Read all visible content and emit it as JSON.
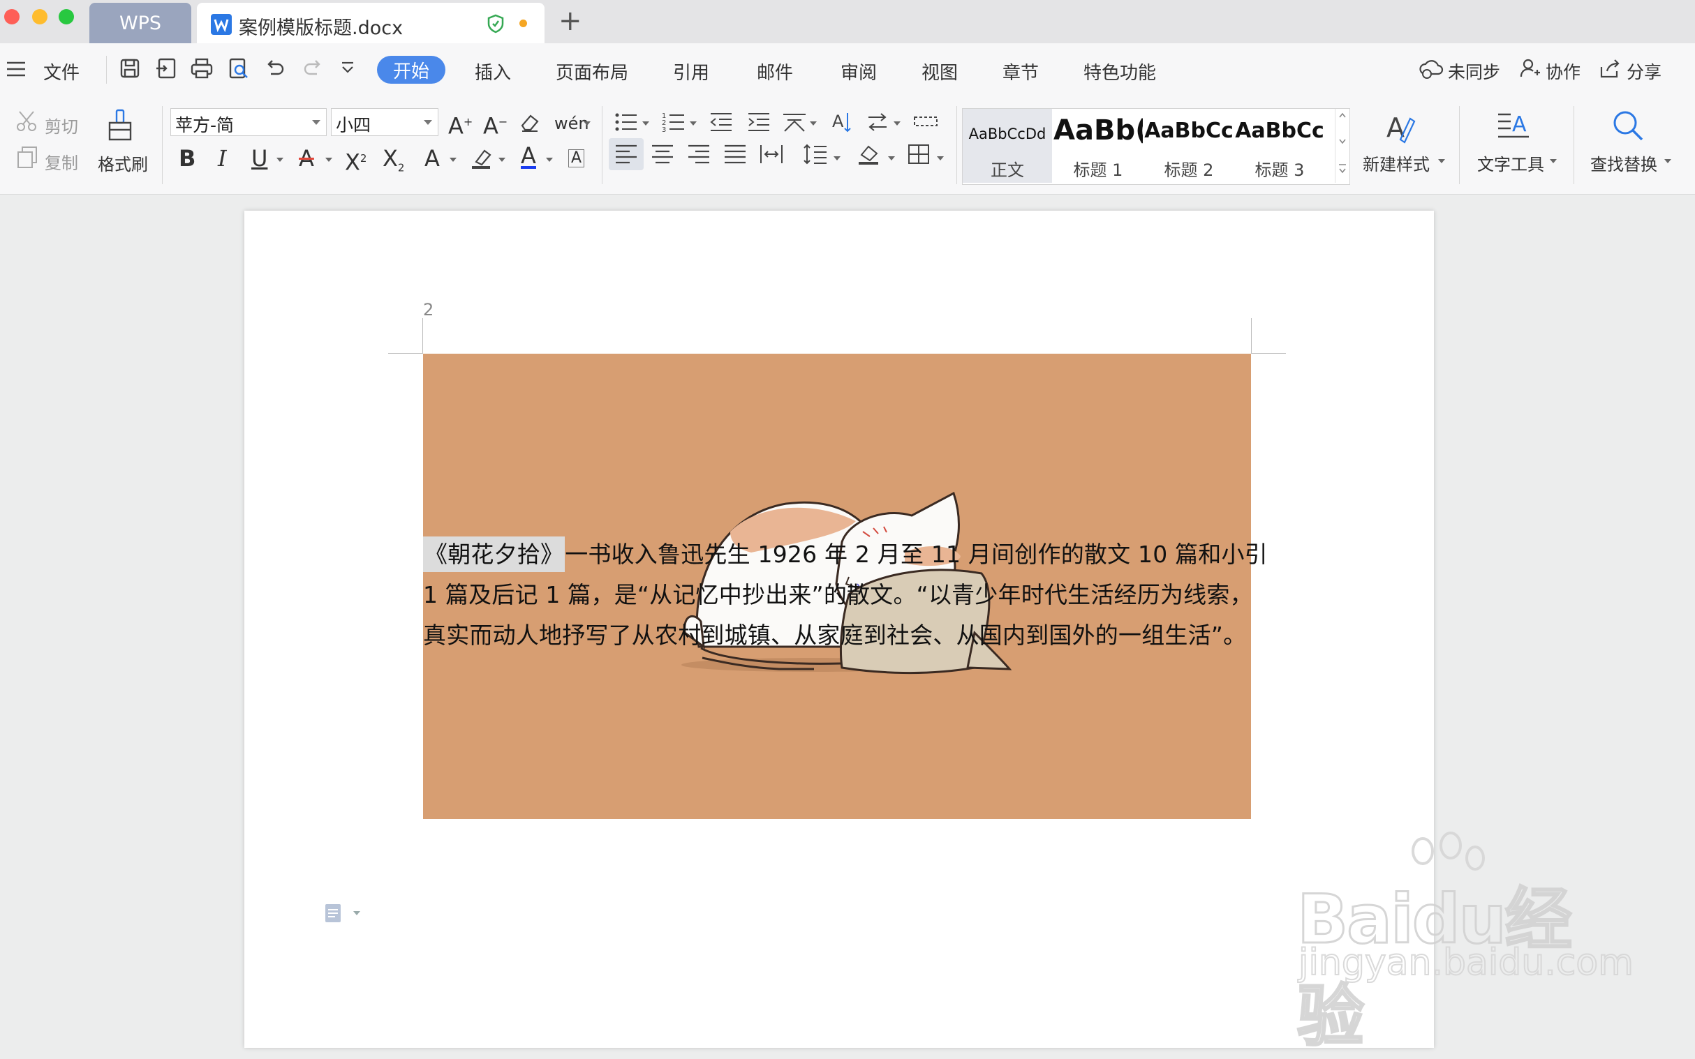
{
  "window": {
    "tabs": [
      {
        "label": "WPS"
      },
      {
        "label": "案例模版标题.docx"
      }
    ]
  },
  "menu": {
    "file_label": "文件",
    "tabs": [
      "开始",
      "插入",
      "页面布局",
      "引用",
      "邮件",
      "审阅",
      "视图",
      "章节",
      "特色功能"
    ],
    "active_tab": "开始",
    "right": {
      "sync": "未同步",
      "collab": "协作",
      "share": "分享"
    }
  },
  "ribbon": {
    "cut": "剪切",
    "copy": "复制",
    "format_painter": "格式刷",
    "font_name": "苹方-简",
    "font_size": "小四",
    "styles": [
      {
        "sample": "AaBbCcDd",
        "name": "正文"
      },
      {
        "sample": "AaBb(",
        "name": "标题 1"
      },
      {
        "sample": "AaBbCc",
        "name": "标题 2"
      },
      {
        "sample": "AaBbCc",
        "name": "标题 3"
      }
    ],
    "new_style": "新建样式",
    "text_tools": "文字工具",
    "find_replace": "查找替换"
  },
  "document": {
    "page_number": "2",
    "highlighted": "《朝花夕拾》",
    "line1_rest": "一书收入鲁迅先生 1926 年 2 月至 11 月间创作的散文 10 篇和小引",
    "line2": "1 篇及后记 1 篇，是“从记忆中抄出来”的散文。“以青少年时代生活经历为线索，",
    "line3": "真实而动人地抒写了从农村到城镇、从家庭到社会、从国内到国外的一组生活”。"
  },
  "watermark": {
    "logo": "Baidu经验",
    "url": "jingyan.baidu.com"
  },
  "colors": {
    "accent": "#4a88ea",
    "image_bg": "#d79e72",
    "wps_tab": "#9aa5be"
  }
}
